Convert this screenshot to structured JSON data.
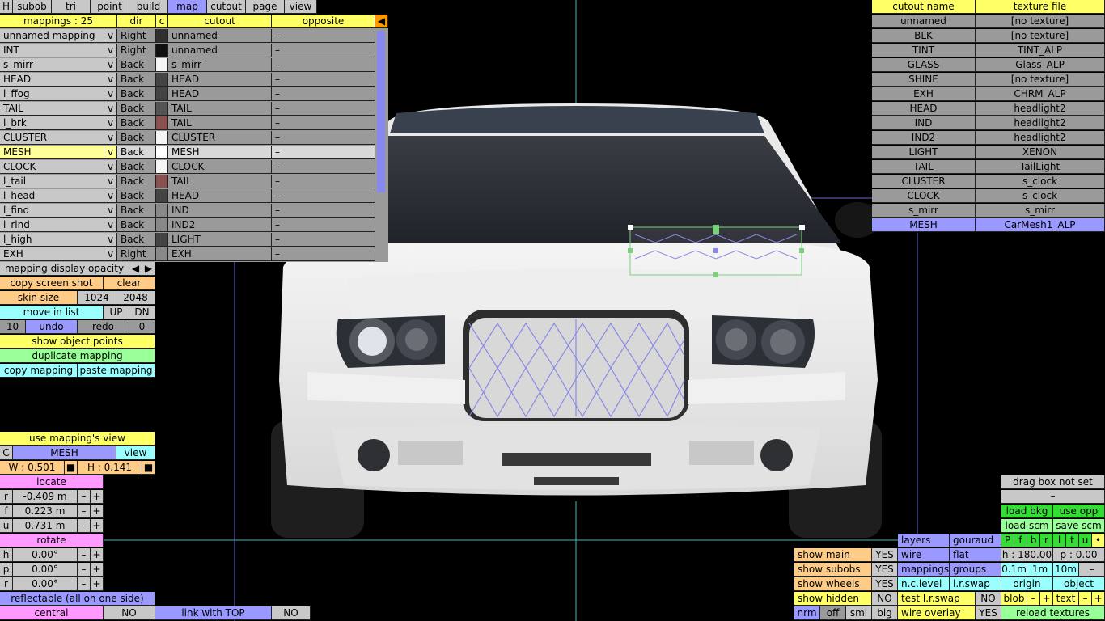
{
  "top_menu": [
    "H",
    "subob",
    "tri",
    "point",
    "build",
    "map",
    "cutout",
    "page",
    "view"
  ],
  "top_menu_active": "map",
  "mappings_header": {
    "count": "mappings : 25",
    "dir": "dir",
    "c": "c",
    "cutout": "cutout",
    "opposite": "opposite"
  },
  "mappings": [
    {
      "name": "unnamed mapping",
      "v": "v",
      "dir": "Right",
      "color": "#303030",
      "cutout": "unnamed",
      "opposite": "–"
    },
    {
      "name": "INT",
      "v": "v",
      "dir": "Right",
      "color": "#111111",
      "cutout": "unnamed",
      "opposite": "–"
    },
    {
      "name": "s_mirr",
      "v": "v",
      "dir": "Back",
      "color": "#f4f4f4",
      "cutout": "s_mirr",
      "opposite": "–"
    },
    {
      "name": "HEAD",
      "v": "v",
      "dir": "Back",
      "color": "#444444",
      "cutout": "HEAD",
      "opposite": "–"
    },
    {
      "name": "l_ffog",
      "v": "v",
      "dir": "Back",
      "color": "#444444",
      "cutout": "HEAD",
      "opposite": "–"
    },
    {
      "name": "TAIL",
      "v": "v",
      "dir": "Back",
      "color": "#555555",
      "cutout": "TAIL",
      "opposite": "–"
    },
    {
      "name": "l_brk",
      "v": "v",
      "dir": "Back",
      "color": "#8a5050",
      "cutout": "TAIL",
      "opposite": "–"
    },
    {
      "name": "CLUSTER",
      "v": "v",
      "dir": "Back",
      "color": "#f4f4f4",
      "cutout": "CLUSTER",
      "opposite": "–"
    },
    {
      "name": "MESH",
      "v": "v",
      "dir": "Back",
      "color": "#ffffff",
      "cutout": "MESH",
      "opposite": "–"
    },
    {
      "name": "CLOCK",
      "v": "v",
      "dir": "Back",
      "color": "#f4f4f4",
      "cutout": "CLOCK",
      "opposite": "–"
    },
    {
      "name": "l_tail",
      "v": "v",
      "dir": "Back",
      "color": "#8a5050",
      "cutout": "TAIL",
      "opposite": "–"
    },
    {
      "name": "l_head",
      "v": "v",
      "dir": "Back",
      "color": "#444444",
      "cutout": "HEAD",
      "opposite": "–"
    },
    {
      "name": "l_find",
      "v": "v",
      "dir": "Back",
      "color": "#888888",
      "cutout": "IND",
      "opposite": "–"
    },
    {
      "name": "l_rind",
      "v": "v",
      "dir": "Back",
      "color": "#888888",
      "cutout": "IND2",
      "opposite": "–"
    },
    {
      "name": "l_high",
      "v": "v",
      "dir": "Back",
      "color": "#444444",
      "cutout": "LIGHT",
      "opposite": "–"
    },
    {
      "name": "EXH",
      "v": "v",
      "dir": "Right",
      "color": "#888888",
      "cutout": "EXH",
      "opposite": "–"
    }
  ],
  "selected_mapping": "MESH",
  "left_panel": {
    "opacity": "mapping display opacity",
    "copy_shot": "copy screen shot",
    "clear": "clear",
    "skin_size": "skin size",
    "skin_w": "1024",
    "skin_h": "2048",
    "move": "move in list",
    "up": "UP",
    "dn": "DN",
    "undo_count": "10",
    "undo": "undo",
    "redo": "redo",
    "redo_count": "0",
    "show_points": "show object points",
    "duplicate": "duplicate mapping",
    "copy": "copy mapping",
    "paste": "paste mapping",
    "use_view": "use mapping's view",
    "c": "C",
    "mesh": "MESH",
    "view": "view",
    "w": "W : 0.501",
    "h": "H : 0.141",
    "locate": "locate",
    "loc": [
      {
        "k": "r",
        "v": "-0.409 m"
      },
      {
        "k": "f",
        "v": "0.223 m"
      },
      {
        "k": "u",
        "v": "0.731 m"
      }
    ],
    "rotate": "rotate",
    "rot": [
      {
        "k": "h",
        "v": "0.00°"
      },
      {
        "k": "p",
        "v": "0.00°"
      },
      {
        "k": "r",
        "v": "0.00°"
      }
    ],
    "minus": "–",
    "plus": "+",
    "reflectable": "reflectable (all on one side)",
    "central": "central",
    "central_v": "NO",
    "link": "link with TOP",
    "link_v": "NO"
  },
  "cutouts_header": {
    "name": "cutout name",
    "tex": "texture file"
  },
  "cutouts": [
    {
      "name": "unnamed",
      "tex": "[no texture]"
    },
    {
      "name": "BLK",
      "tex": "[no texture]"
    },
    {
      "name": "TINT",
      "tex": "TINT_ALP"
    },
    {
      "name": "GLASS",
      "tex": "Glass_ALP"
    },
    {
      "name": "SHINE",
      "tex": "[no texture]"
    },
    {
      "name": "EXH",
      "tex": "CHRM_ALP"
    },
    {
      "name": "HEAD",
      "tex": "headlight2"
    },
    {
      "name": "IND",
      "tex": "headlight2"
    },
    {
      "name": "IND2",
      "tex": "headlight2"
    },
    {
      "name": "LIGHT",
      "tex": "XENON"
    },
    {
      "name": "TAIL",
      "tex": "TailLight"
    },
    {
      "name": "CLUSTER",
      "tex": "s_clock"
    },
    {
      "name": "CLOCK",
      "tex": "s_clock"
    },
    {
      "name": "s_mirr",
      "tex": "s_mirr"
    },
    {
      "name": "MESH",
      "tex": "CarMesh1_ALP"
    }
  ],
  "bottom_panel": {
    "show_main": "show main",
    "show_main_v": "YES",
    "show_subobs": "show subobs",
    "show_subobs_v": "YES",
    "show_wheels": "show wheels",
    "show_wheels_v": "YES",
    "show_hidden": "show hidden",
    "show_hidden_v": "NO",
    "nrm": "nrm",
    "off": "off",
    "sml": "sml",
    "big": "big",
    "layers": "layers",
    "gouraud": "gouraud",
    "wire": "wire",
    "flat": "flat",
    "mappings": "mappings",
    "groups": "groups",
    "nclevel": "n.c.level",
    "lrswap": "l.r.swap",
    "test_lr": "test l.r.swap",
    "test_lr_v": "NO",
    "wire_overlay": "wire overlay",
    "wire_overlay_v": "YES",
    "dragbox": "drag box not set",
    "dash": "–",
    "load_bkg": "load bkg",
    "use_opp": "use opp",
    "load_scm": "load scm",
    "save_scm": "save scm",
    "letters": [
      "P",
      "f",
      "b",
      "r",
      "l",
      "t",
      "u",
      "•"
    ],
    "h": "h : 180.00",
    "p": "p : 0.00",
    "z1": "0.1m",
    "z2": "1m",
    "z3": "10m",
    "zdash": "–",
    "origin": "origin",
    "object": "object",
    "blob": "blob",
    "text": "text",
    "minus": "–",
    "plus": "+",
    "reload": "reload textures"
  }
}
